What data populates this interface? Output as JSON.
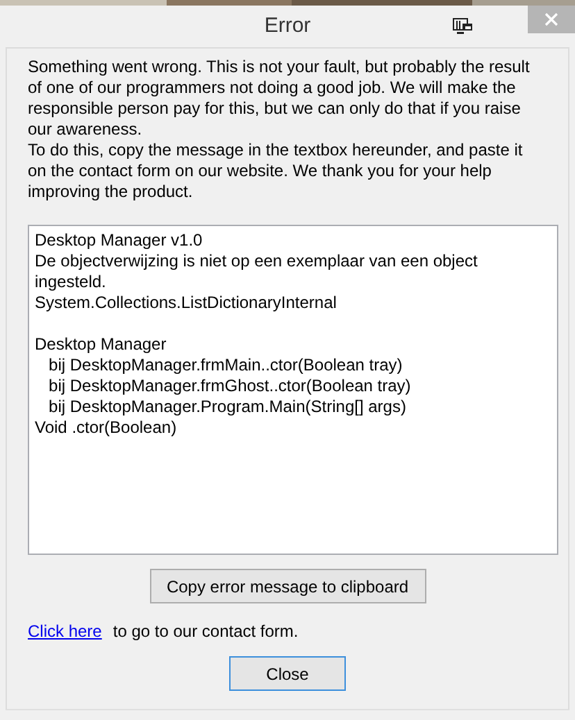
{
  "window": {
    "title": "Error"
  },
  "intro": [
    "Something went wrong. This is not your fault, but probably the result of one of our programmers not doing a good job. We will make the responsible person pay for this, but we can only do that if you raise our awareness.",
    "To do this, copy the message in the textbox hereunder, and paste it on the contact form on our website. We thank you for your help improving the product."
  ],
  "error_text": [
    [
      "Desktop Manager v1.0",
      "De objectverwijzing is niet op een exemplaar van een object ingesteld.",
      "System.Collections.ListDictionaryInternal"
    ],
    [
      "Desktop Manager",
      "   bij DesktopManager.frmMain..ctor(Boolean tray)",
      "   bij DesktopManager.frmGhost..ctor(Boolean tray)",
      "   bij DesktopManager.Program.Main(String[] args)",
      "Void .ctor(Boolean)"
    ]
  ],
  "copy_button": "Copy error message to clipboard",
  "contact": {
    "link": "Click here",
    "text": "to go to our contact form."
  },
  "close_button": "Close"
}
